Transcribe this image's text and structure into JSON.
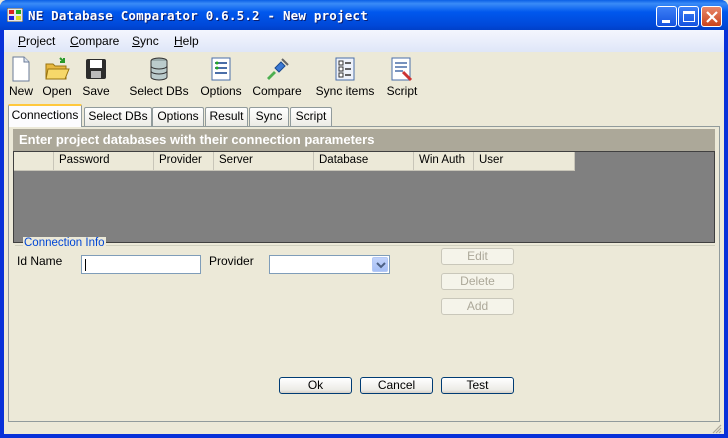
{
  "window": {
    "title": "NE Database Comparator 0.6.5.2 - New project",
    "buttons": {
      "minimize": "minimize",
      "maximize": "maximize",
      "close": "close"
    }
  },
  "menu": [
    "Project",
    "Compare",
    "Sync",
    "Help"
  ],
  "toolbar": [
    {
      "label": "New",
      "icon": "new-file-icon"
    },
    {
      "label": "Open",
      "icon": "open-folder-icon"
    },
    {
      "label": "Save",
      "icon": "save-disk-icon"
    },
    {
      "label": "Select DBs",
      "icon": "database-icon"
    },
    {
      "label": "Options",
      "icon": "options-icon"
    },
    {
      "label": "Compare",
      "icon": "compare-icon"
    },
    {
      "label": "Sync items",
      "icon": "sync-items-icon"
    },
    {
      "label": "Script",
      "icon": "script-icon"
    }
  ],
  "tabs": [
    {
      "label": "Connections",
      "active": true
    },
    {
      "label": "Select DBs",
      "active": false
    },
    {
      "label": "Options",
      "active": false
    },
    {
      "label": "Result",
      "active": false
    },
    {
      "label": "Sync",
      "active": false
    },
    {
      "label": "Script",
      "active": false
    }
  ],
  "connections": {
    "caption": "Enter project databases with their connection parameters",
    "columns": [
      "",
      "Password",
      "Provider",
      "Server",
      "Database",
      "Win Auth",
      "User"
    ],
    "rows": []
  },
  "connection_info": {
    "group_label": "Connection Info",
    "id_name_label": "Id Name",
    "id_name_value": "",
    "provider_label": "Provider",
    "provider_value": "",
    "buttons": {
      "edit": "Edit",
      "delete": "Delete",
      "add": "Add"
    }
  },
  "footer_buttons": {
    "ok": "Ok",
    "cancel": "Cancel",
    "test": "Test"
  },
  "colors": {
    "title_bar": "#0054e3",
    "accent_tab": "#ffc83c",
    "grid_bg": "#808080",
    "caption_bg": "#aca899",
    "group_label": "#0046d5"
  }
}
